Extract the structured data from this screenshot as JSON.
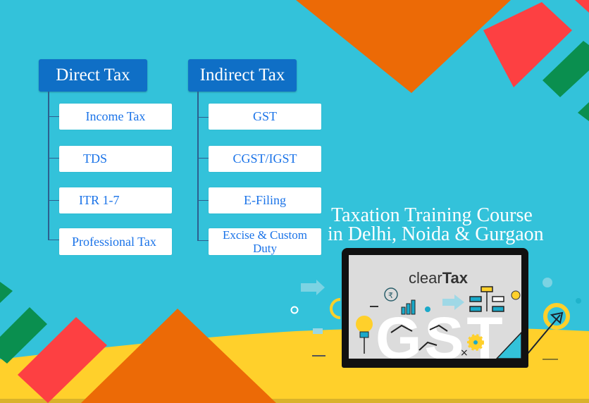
{
  "colors": {
    "background": "#33c2da",
    "header_box": "#0f6fc6",
    "item_text": "#1a73e8",
    "orange": "#ec6a06",
    "red": "#fd4042",
    "green": "#0a8f4f",
    "yellow": "#ffd02b"
  },
  "direct_tax": {
    "title": "Direct Tax",
    "items": [
      "Income Tax",
      "TDS",
      "ITR 1-7",
      "Professional Tax"
    ]
  },
  "indirect_tax": {
    "title": "Indirect Tax",
    "items": [
      "GST",
      "CGST/IGST",
      "E-Filing",
      "Excise & Custom Duty"
    ]
  },
  "tagline": {
    "line1": "Taxation Training Course",
    "line2": "in Delhi, Noida & Gurgaon"
  },
  "laptop": {
    "brand_light": "clear",
    "brand_bold": "Tax",
    "big_text": "GST",
    "icons": [
      "rupee-coin-icon",
      "bar-chart-icon",
      "arrow-right-icon",
      "flowchart-icon",
      "lightbulb-icon",
      "gear-icon"
    ]
  }
}
